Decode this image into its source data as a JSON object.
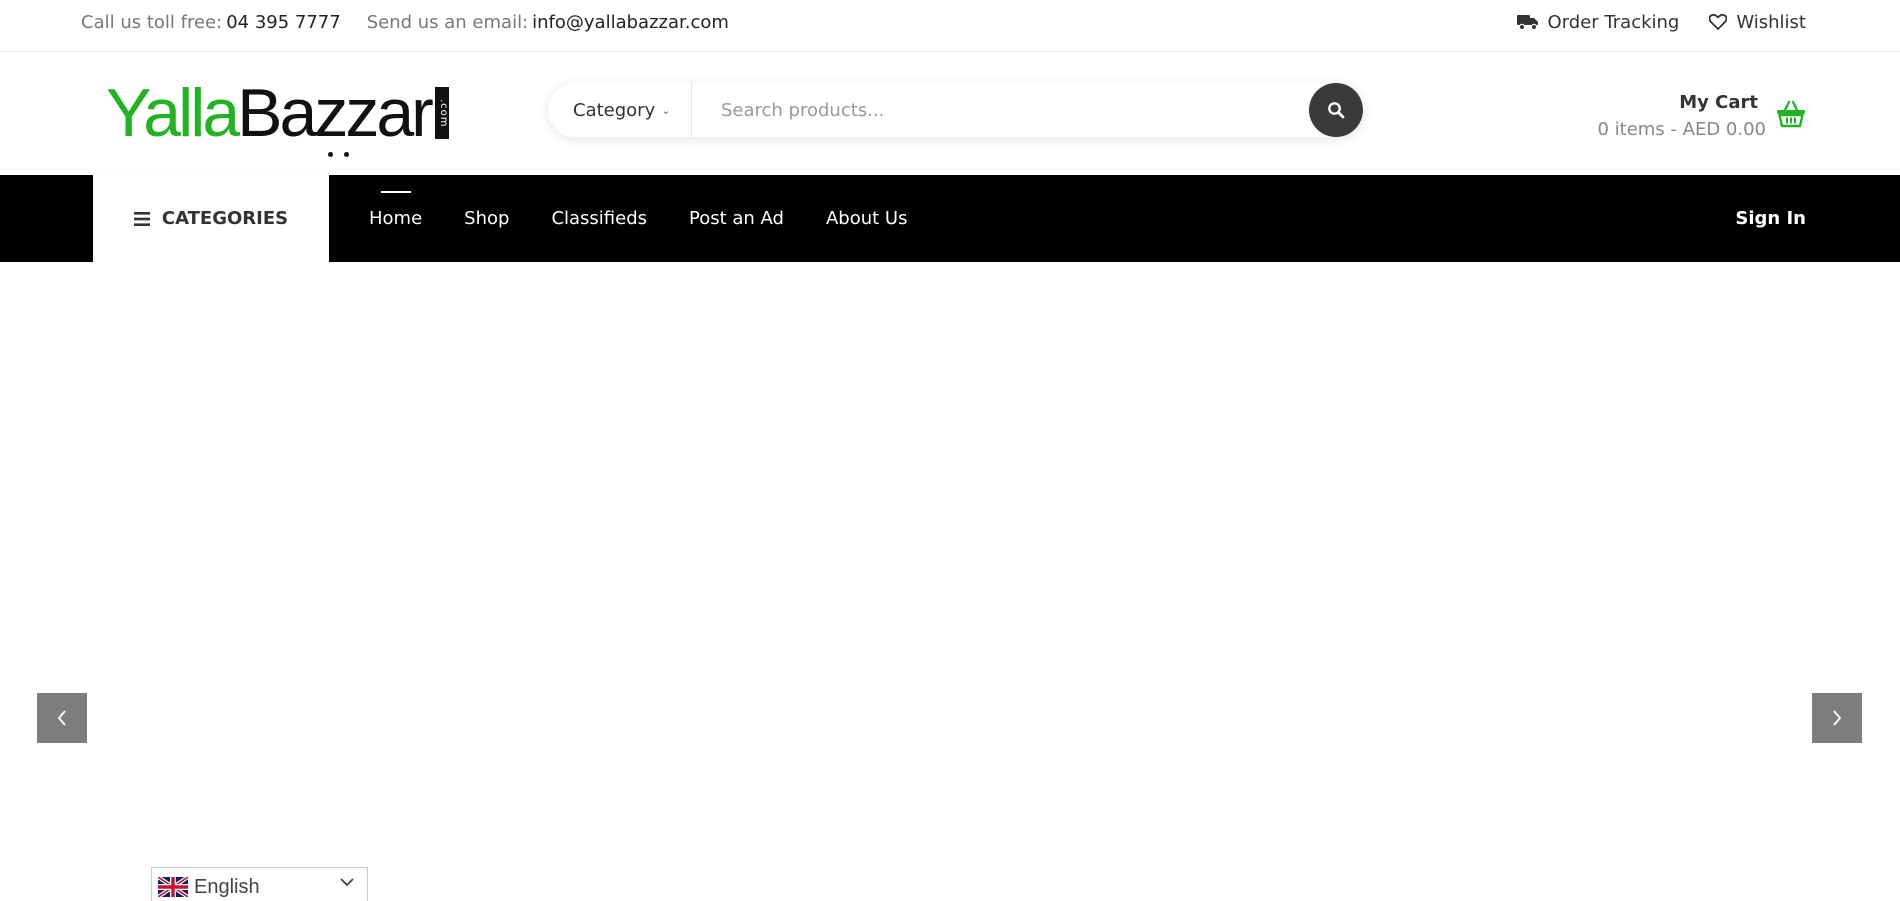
{
  "topbar": {
    "call_label": "Call us toll free:",
    "phone": "04 395 7777",
    "email_label": "Send us an email:",
    "email": "info@yallabazzar.com",
    "order_tracking": "Order Tracking",
    "wishlist": "Wishlist"
  },
  "logo": {
    "part1": "Yalla",
    "part2": "Bazzar",
    "suffix": ".com"
  },
  "search": {
    "category_label": "Category",
    "placeholder": "Search products..."
  },
  "cart": {
    "title": "My Cart",
    "summary": "0 items - AED 0.00"
  },
  "nav": {
    "categories_label": "CATEGORIES",
    "items": [
      "Home",
      "Shop",
      "Classifieds",
      "Post an Ad",
      "About Us"
    ],
    "active": "Home",
    "sign_in": "Sign In"
  },
  "language": {
    "selected": "English"
  },
  "colors": {
    "brand_green": "#22b322",
    "nav_background": "#000000",
    "search_button": "#3a3a3a",
    "slider_arrow": "#7d7d7d"
  }
}
